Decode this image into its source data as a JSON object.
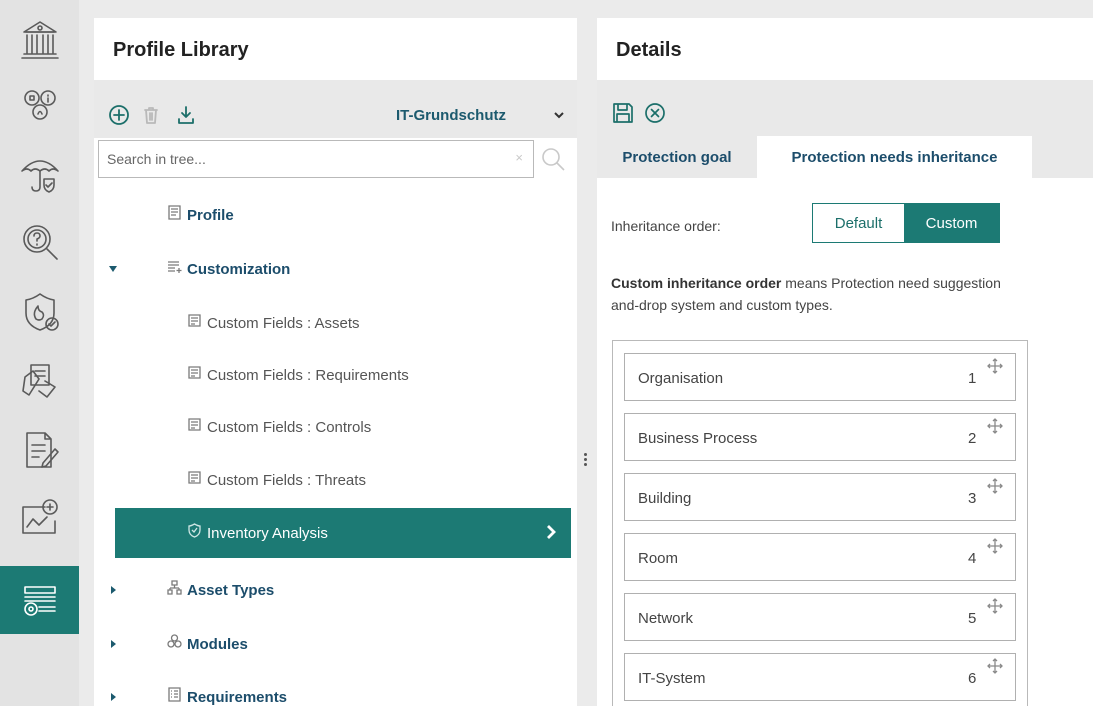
{
  "library": {
    "title": "Profile Library",
    "selected_profile": "IT-Grundschutz",
    "search_placeholder": "Search in tree...",
    "search_clear": "×",
    "tree": [
      {
        "label": "Profile",
        "icon": "document-icon"
      },
      {
        "label": "Customization",
        "icon": "list-add-icon",
        "expanded": true
      },
      {
        "label": "Custom Fields : Assets",
        "icon": "form-icon"
      },
      {
        "label": "Custom Fields : Requirements",
        "icon": "form-icon"
      },
      {
        "label": "Custom Fields : Controls",
        "icon": "form-icon"
      },
      {
        "label": "Custom Fields : Threats",
        "icon": "form-icon"
      },
      {
        "label": "Inventory Analysis",
        "icon": "shield-icon",
        "selected": true
      },
      {
        "label": "Asset Types",
        "icon": "hierarchy-icon",
        "expanded": false
      },
      {
        "label": "Modules",
        "icon": "modules-icon",
        "expanded": false
      },
      {
        "label": "Requirements",
        "icon": "requirements-icon",
        "expanded": false
      }
    ]
  },
  "details": {
    "title": "Details",
    "tabs": [
      "Protection goal",
      "Protection needs inheritance"
    ],
    "active_tab": "Protection needs inheritance",
    "inheritance_label": "Inheritance order:",
    "toggle": {
      "default": "Default",
      "custom": "Custom",
      "selected": "Custom"
    },
    "description_bold": "Custom inheritance order",
    "description_rest": " means Protection need suggestion",
    "description_line2": "and-drop system and custom types.",
    "order": [
      {
        "name": "Organisation",
        "rank": "1"
      },
      {
        "name": "Business Process",
        "rank": "2"
      },
      {
        "name": "Building",
        "rank": "3"
      },
      {
        "name": "Room",
        "rank": "4"
      },
      {
        "name": "Network",
        "rank": "5"
      },
      {
        "name": "IT-System",
        "rank": "6"
      }
    ]
  },
  "colors": {
    "accent": "#1c7a74",
    "heading": "#1c4d6b"
  },
  "rail_icons": [
    "bank-icon",
    "roles-icon",
    "umbrella-shield-icon",
    "search-question-icon",
    "fire-shield-icon",
    "document-tag-icon",
    "edit-document-icon",
    "report-chart-icon",
    "library-settings-icon"
  ]
}
